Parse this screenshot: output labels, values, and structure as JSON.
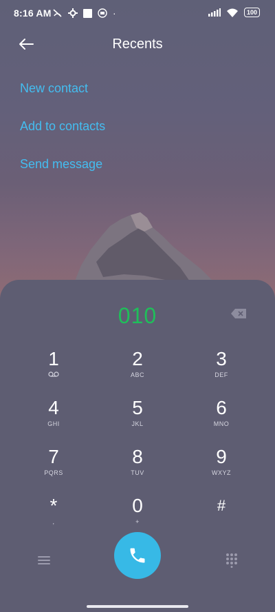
{
  "status_bar": {
    "time": "8:16 AM",
    "battery": "100",
    "dot": "·"
  },
  "header": {
    "title": "Recents",
    "back_icon": "back-arrow-icon"
  },
  "actions": [
    "New contact",
    "Add to contacts",
    "Send message"
  ],
  "dialer": {
    "number": "010",
    "keys": [
      {
        "digit": "1",
        "letters": "ooo"
      },
      {
        "digit": "2",
        "letters": "ABC"
      },
      {
        "digit": "3",
        "letters": "DEF"
      },
      {
        "digit": "4",
        "letters": "GHI"
      },
      {
        "digit": "5",
        "letters": "JKL"
      },
      {
        "digit": "6",
        "letters": "MNO"
      },
      {
        "digit": "7",
        "letters": "PQRS"
      },
      {
        "digit": "8",
        "letters": "TUV"
      },
      {
        "digit": "9",
        "letters": "WXYZ"
      },
      {
        "digit": "*",
        "letters": ","
      },
      {
        "digit": "0",
        "letters": "+"
      },
      {
        "digit": "#",
        "letters": ""
      }
    ]
  },
  "colors": {
    "accent": "#44bdf0",
    "number": "#1fbf5a",
    "call_button": "#37b9e6",
    "panel": "#5e5d72"
  }
}
